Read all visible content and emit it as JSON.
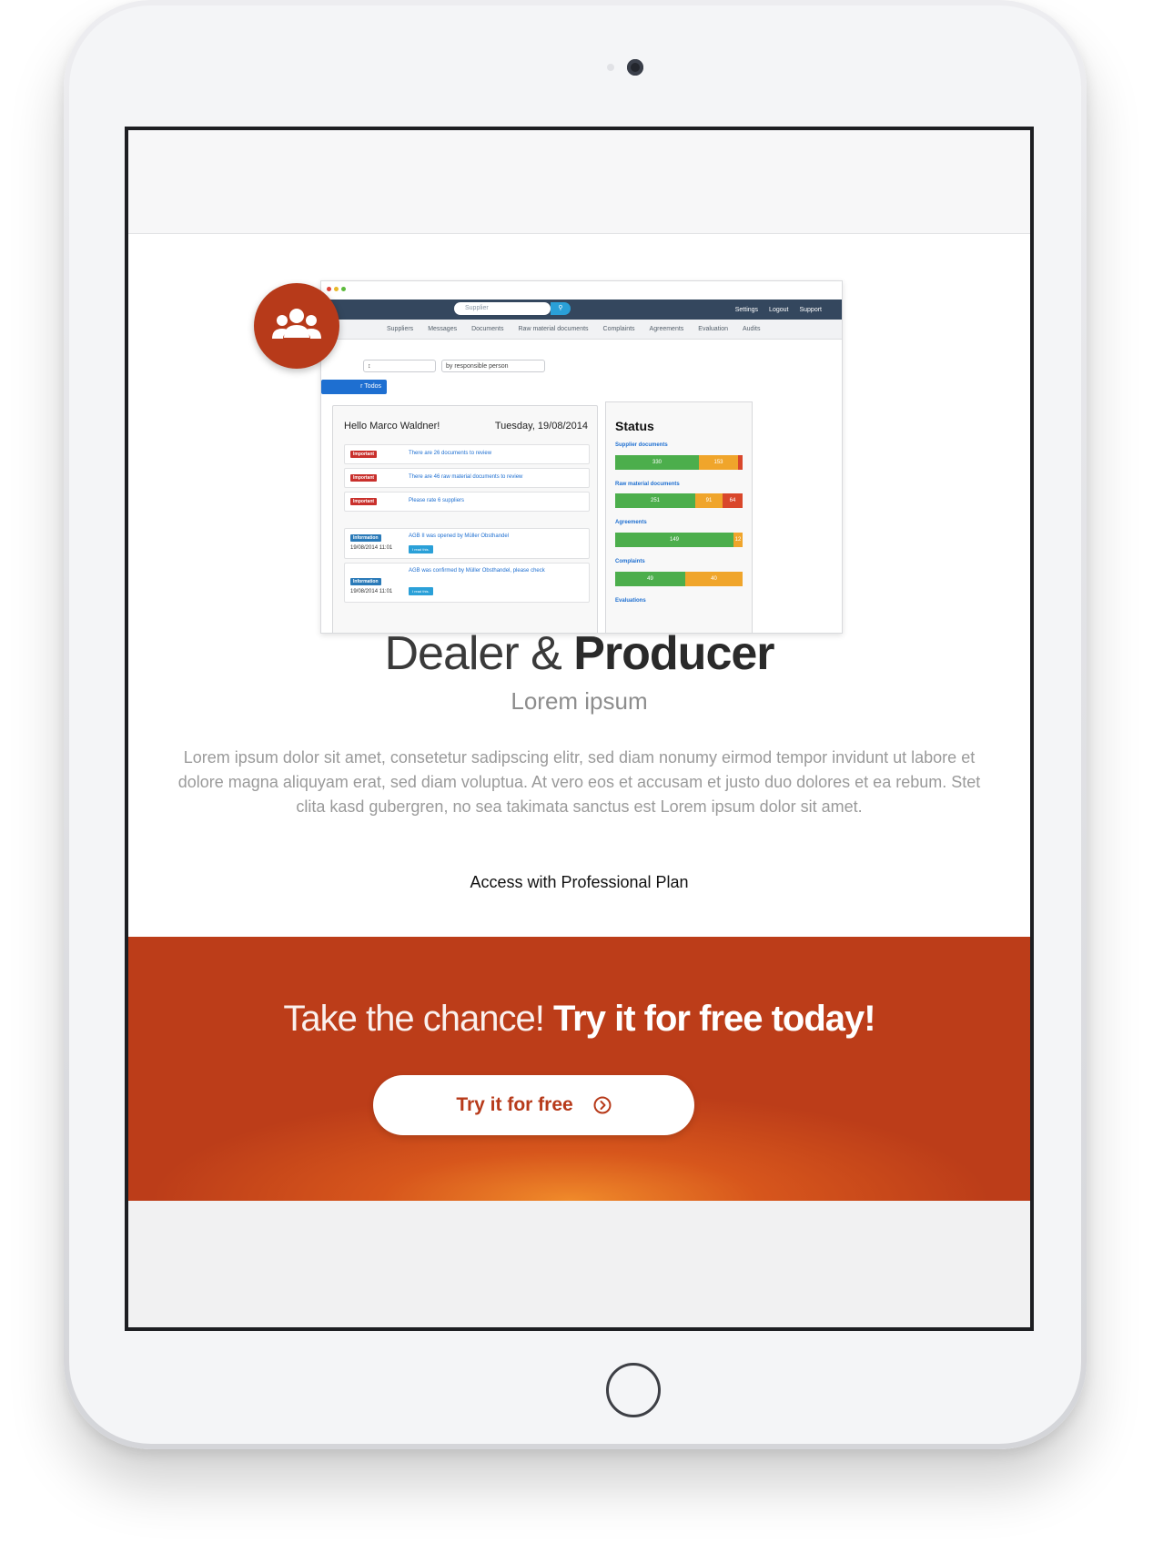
{
  "mockup": {
    "search_placeholder": "Supplier",
    "nav_links": [
      "Settings",
      "Logout",
      "Support"
    ],
    "tabs": [
      "Suppliers",
      "Messages",
      "Documents",
      "Raw material documents",
      "Complaints",
      "Agreements",
      "Evaluation",
      "Audits"
    ],
    "select_responsible": "by responsible person",
    "todo_button": "r Todos",
    "greeting": "Hello Marco Waldner!",
    "date": "Tuesday, 19/08/2014",
    "important_rows": [
      {
        "badge": "Important",
        "text": "There are 26 documents to review"
      },
      {
        "badge": "Important",
        "text": "There are 46 raw material documents to review"
      },
      {
        "badge": "Important",
        "text": "Please rate 6 suppliers"
      }
    ],
    "info_rows": [
      {
        "badge": "Information",
        "timestamp": "19/08/2014 11:01",
        "text": "AGB II was opened by Müller Obsthandel",
        "button": "I read this."
      },
      {
        "badge": "Information",
        "timestamp": "19/08/2014 11:01",
        "text": "AGB was confirmed by Müller Obsthandel, please check",
        "button": "I read this."
      }
    ],
    "status": {
      "title": "Status",
      "groups": [
        {
          "label": "Supplier documents",
          "values": [
            330,
            153,
            6
          ]
        },
        {
          "label": "Raw material documents",
          "values": [
            251,
            91,
            64
          ]
        },
        {
          "label": "Agreements",
          "values": [
            149,
            12
          ]
        },
        {
          "label": "Complaints",
          "values": [
            49,
            40
          ]
        },
        {
          "label": "Evaluations",
          "values": []
        }
      ]
    }
  },
  "hero": {
    "title_light": "Dealer & ",
    "title_bold": "Producer",
    "subtitle": "Lorem ipsum",
    "body": "Lorem ipsum dolor sit amet, consetetur sadipscing elitr, sed diam nonumy eirmod tempor invidunt ut labore et dolore magna aliquyam erat, sed diam voluptua. At vero eos et accusam et justo duo dolores et ea rebum. Stet clita kasd gubergren, no sea takimata sanctus est Lorem ipsum dolor sit amet.",
    "access": "Access with Professional Plan"
  },
  "cta": {
    "heading_light": "Take the chance! ",
    "heading_bold": "Try it for free today!",
    "button_label": "Try it for free",
    "button_icon": "chevron-right-circle-icon"
  },
  "colors": {
    "accent": "#b73a1a",
    "success": "#4cae4c",
    "warning": "#f0a52b",
    "danger": "#d9472b"
  }
}
